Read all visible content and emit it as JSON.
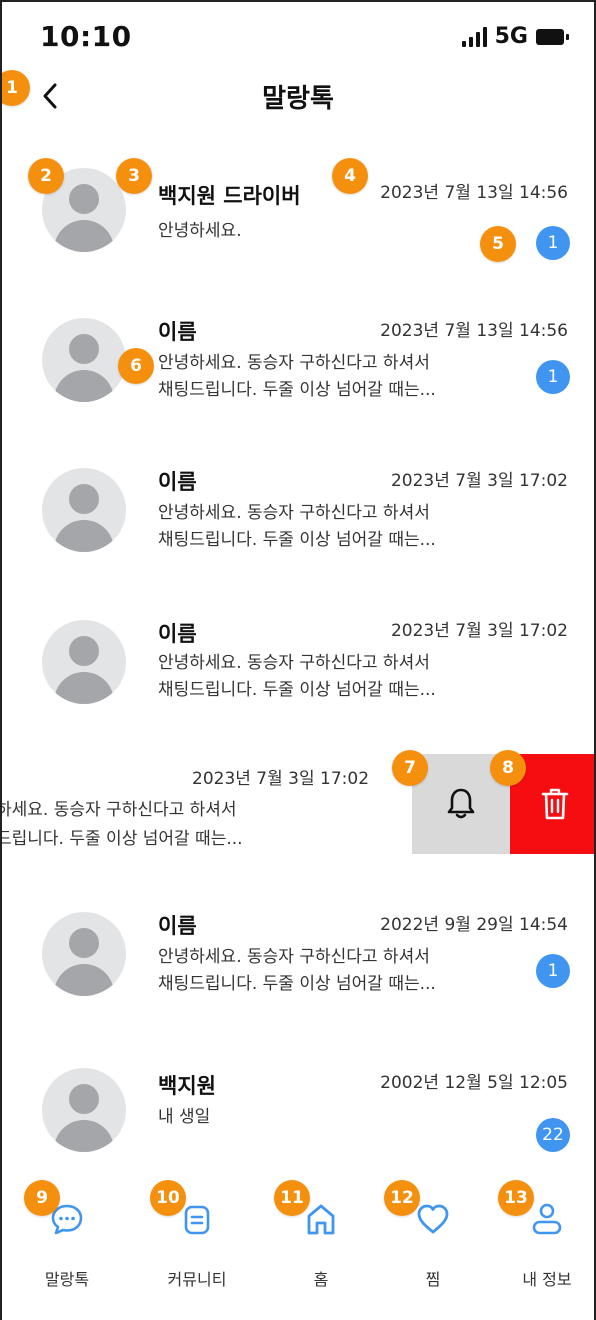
{
  "status_bar": {
    "time": "10:10",
    "network": "5G"
  },
  "header": {
    "title": "말랑톡",
    "back_icon": "chevron-left-icon"
  },
  "markers": [
    "1",
    "2",
    "3",
    "4",
    "5",
    "6",
    "7",
    "8",
    "9",
    "10",
    "11",
    "12",
    "13"
  ],
  "chats": [
    {
      "name": "백지원 드라이버",
      "time": "2023년 7월 13일 14:56",
      "preview": [
        "안녕하세요."
      ],
      "unread": "1"
    },
    {
      "name": "이름",
      "time": "2023년 7월 13일 14:56",
      "preview": [
        "안녕하세요. 동승자 구하신다고 하셔서",
        "채팅드립니다. 두줄 이상 넘어갈 때는..."
      ],
      "unread": "1"
    },
    {
      "name": "이름",
      "time": "2023년 7월 3일 17:02",
      "preview": [
        "안녕하세요. 동승자 구하신다고 하셔서",
        "채팅드립니다. 두줄 이상 넘어갈 때는..."
      ],
      "unread": null
    },
    {
      "name": "이름",
      "time": "2023년 7월 3일 17:02",
      "preview": [
        "안녕하세요. 동승자 구하신다고 하셔서",
        "채팅드립니다. 두줄 이상 넘어갈 때는..."
      ],
      "unread": null
    },
    {
      "name": "이름",
      "time": "2022년 9월 29일 14:54",
      "preview": [
        "안녕하세요. 동승자 구하신다고 하셔서",
        "채팅드립니다. 두줄 이상 넘어갈 때는..."
      ],
      "unread": "1"
    },
    {
      "name": "백지원",
      "time": "2002년 12월 5일 12:05",
      "preview": [
        "내 생일"
      ],
      "unread": "22"
    }
  ],
  "swiped_chat": {
    "time": "2023년 7월 3일 17:02",
    "preview": [
      "하세요. 동승자 구하신다고 하셔서",
      "드립니다. 두줄 이상 넘어갈 때는..."
    ],
    "mute_icon": "bell-icon",
    "delete_icon": "trash-icon",
    "delete_color": "#f50d12"
  },
  "bottom_nav": [
    {
      "label": "말랑톡",
      "icon": "chat-bubble-icon",
      "active": true
    },
    {
      "label": "커뮤니티",
      "icon": "community-icon",
      "active": true
    },
    {
      "label": "홈",
      "icon": "home-icon",
      "active": true
    },
    {
      "label": "찜",
      "icon": "heart-icon",
      "active": true
    },
    {
      "label": "내 정보",
      "icon": "profile-icon",
      "active": true
    }
  ],
  "colors": {
    "accent": "#3f95f0",
    "marker": "#f5900f",
    "avatar_bg": "#e3e4e6"
  }
}
